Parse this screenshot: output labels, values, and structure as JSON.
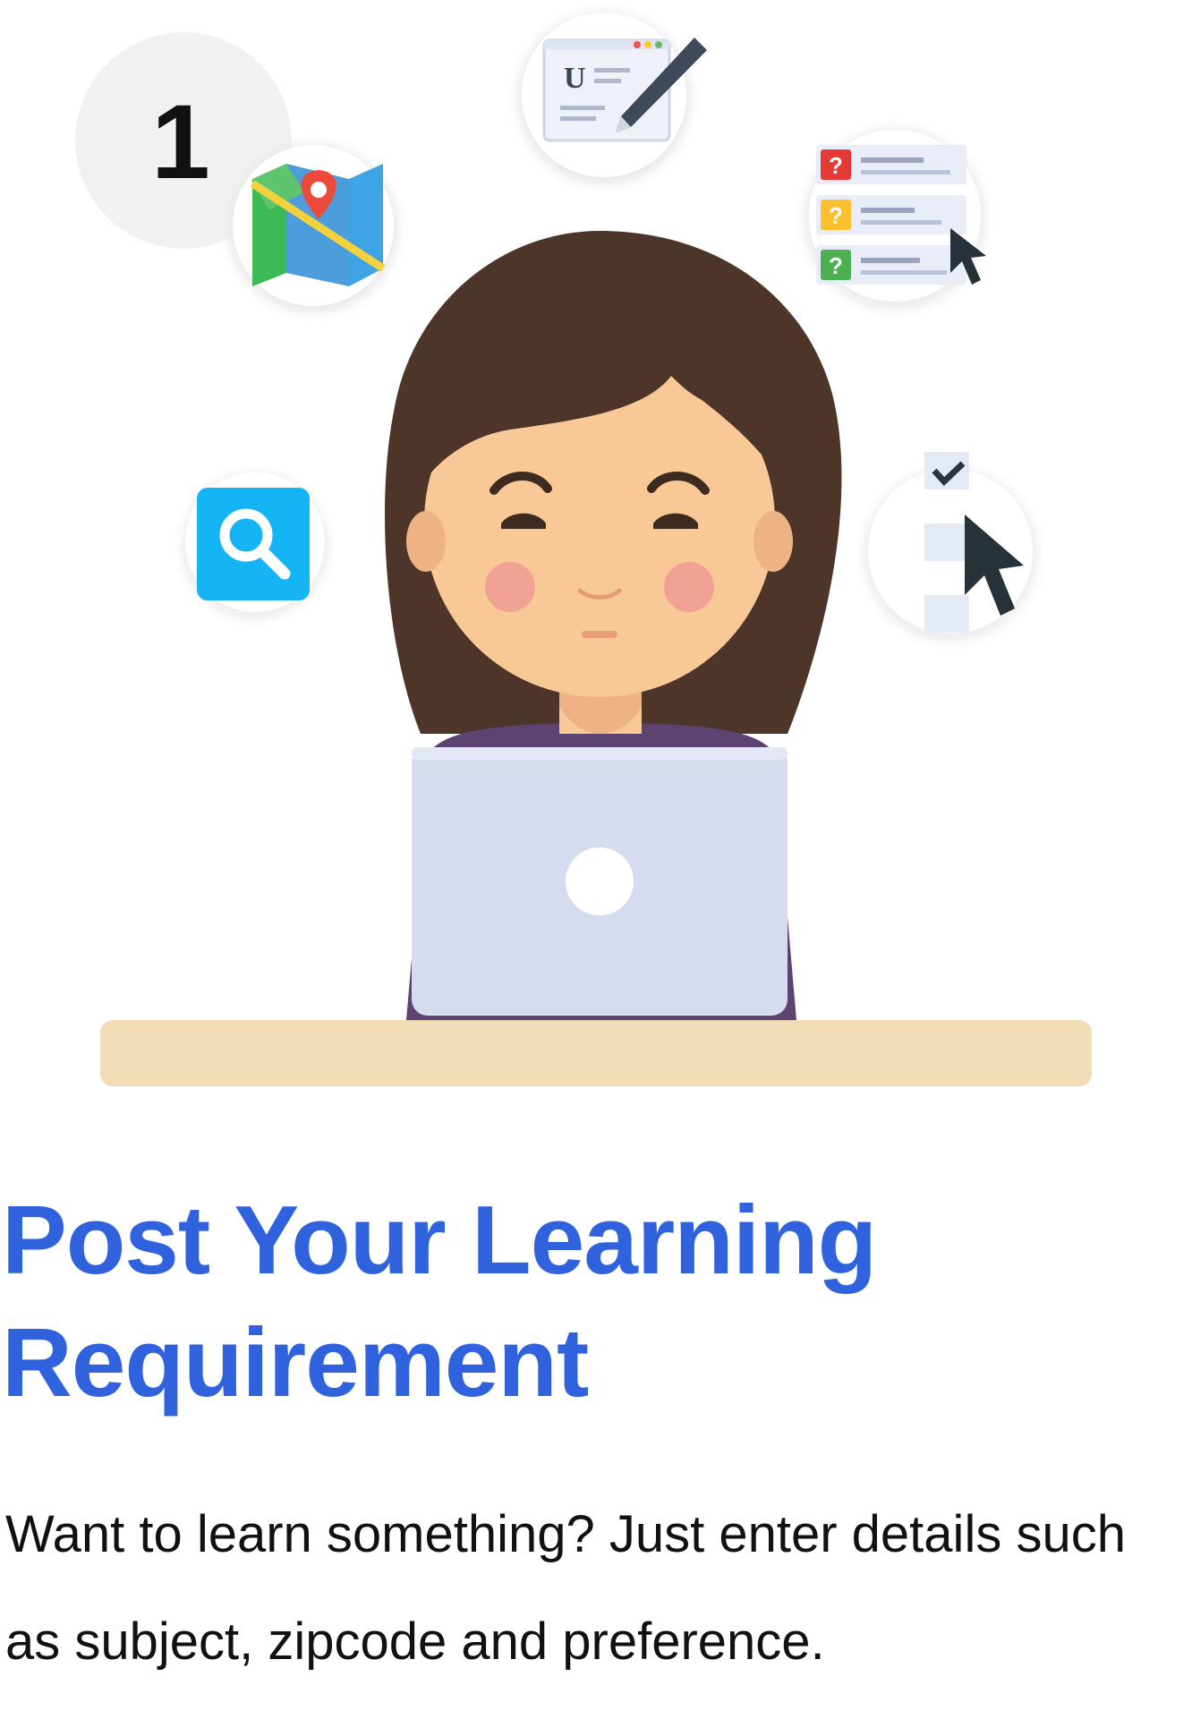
{
  "step": {
    "number": "1",
    "title": "Post Your Learning Requirement",
    "description": "Want to learn something? Just enter details such as subject, zipcode and preference."
  },
  "illustration": {
    "icons": [
      "map-pin-icon",
      "edit-document-icon",
      "question-list-icon",
      "search-icon",
      "checkbox-cursor-icon"
    ],
    "colors": {
      "hair": "#4e3529",
      "skin": "#f8c997",
      "laptop": "#d6dcf0",
      "desk": "#f2dcb6",
      "title": "#2f62dc",
      "search_tile": "#14b4f5"
    }
  }
}
